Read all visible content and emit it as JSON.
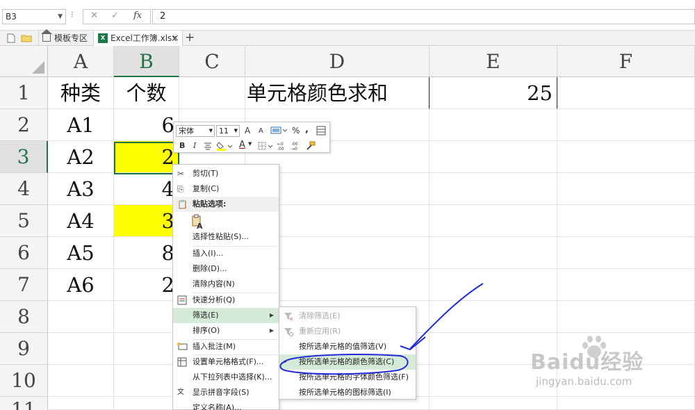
{
  "formula_bar": {
    "cell_ref": "B3",
    "dots": "⁝",
    "cancel": "✕",
    "confirm": "✓",
    "fx": "fx",
    "value": "2"
  },
  "tabs": [
    {
      "label": "模板专区"
    },
    {
      "label": "Excel工作簿.xlsx"
    }
  ],
  "tab_close": "×",
  "tab_add": "+",
  "xl_badge": "X",
  "columns": [
    "A",
    "B",
    "C",
    "D",
    "E",
    "F"
  ],
  "rows": [
    "1",
    "2",
    "3",
    "4",
    "5",
    "6",
    "7",
    "8",
    "9",
    "10",
    "11"
  ],
  "cells": {
    "A1": "种类",
    "B1": "个数",
    "D1": "单元格颜色求和",
    "E1": "25",
    "A2": "A1",
    "B2": "6",
    "A3": "A2",
    "B3": "2",
    "A4": "A3",
    "B4": "4",
    "A5": "A4",
    "B5": "3",
    "A6": "A5",
    "B6": "8",
    "A7": "A6",
    "B7": "2"
  },
  "highlight_color": "#ffff00",
  "accent_color": "#217346",
  "mini_toolbar": {
    "font_name": "宋体",
    "font_size": "11",
    "grow_font": "A",
    "shrink_font": "A",
    "percent": "%",
    "comma": ",",
    "bold": "B",
    "italic": "I",
    "font_color": "A"
  },
  "context_menu": [
    {
      "label": "剪切(T)",
      "icon": "scissors-icon"
    },
    {
      "label": "复制(C)",
      "icon": "copy-icon"
    },
    {
      "label": "粘贴选项:",
      "icon": "paste-icon"
    },
    {
      "label": "选择性粘贴(S)..."
    },
    {
      "label": "插入(I)..."
    },
    {
      "label": "删除(D)..."
    },
    {
      "label": "清除内容(N)"
    },
    {
      "label": "快速分析(Q)",
      "icon": "quick-analysis-icon"
    },
    {
      "label": "筛选(E)"
    },
    {
      "label": "排序(O)"
    },
    {
      "label": "插入批注(M)",
      "icon": "comment-icon"
    },
    {
      "label": "设置单元格格式(F)...",
      "icon": "format-cells-icon"
    },
    {
      "label": "从下拉列表中选择(K)..."
    },
    {
      "label": "显示拼音字段(S)",
      "icon": "phonetic-icon"
    },
    {
      "label": "定义名称(A)..."
    }
  ],
  "submenu_arrow": "▶",
  "submenu": [
    {
      "label": "清除筛选(E)",
      "enabled": false
    },
    {
      "label": "重新应用(R)",
      "enabled": false
    },
    {
      "label": "按所选单元格的值筛选(V)",
      "enabled": true
    },
    {
      "label": "按所选单元格的颜色筛选(C)",
      "enabled": true
    },
    {
      "label": "按所选单元格的字体颜色筛选(F)",
      "enabled": true
    },
    {
      "label": "按所选单元格的图标筛选(I)",
      "enabled": true
    }
  ],
  "watermark": {
    "logo": "Baidu经验",
    "url": "jingyan.baidu.com"
  }
}
